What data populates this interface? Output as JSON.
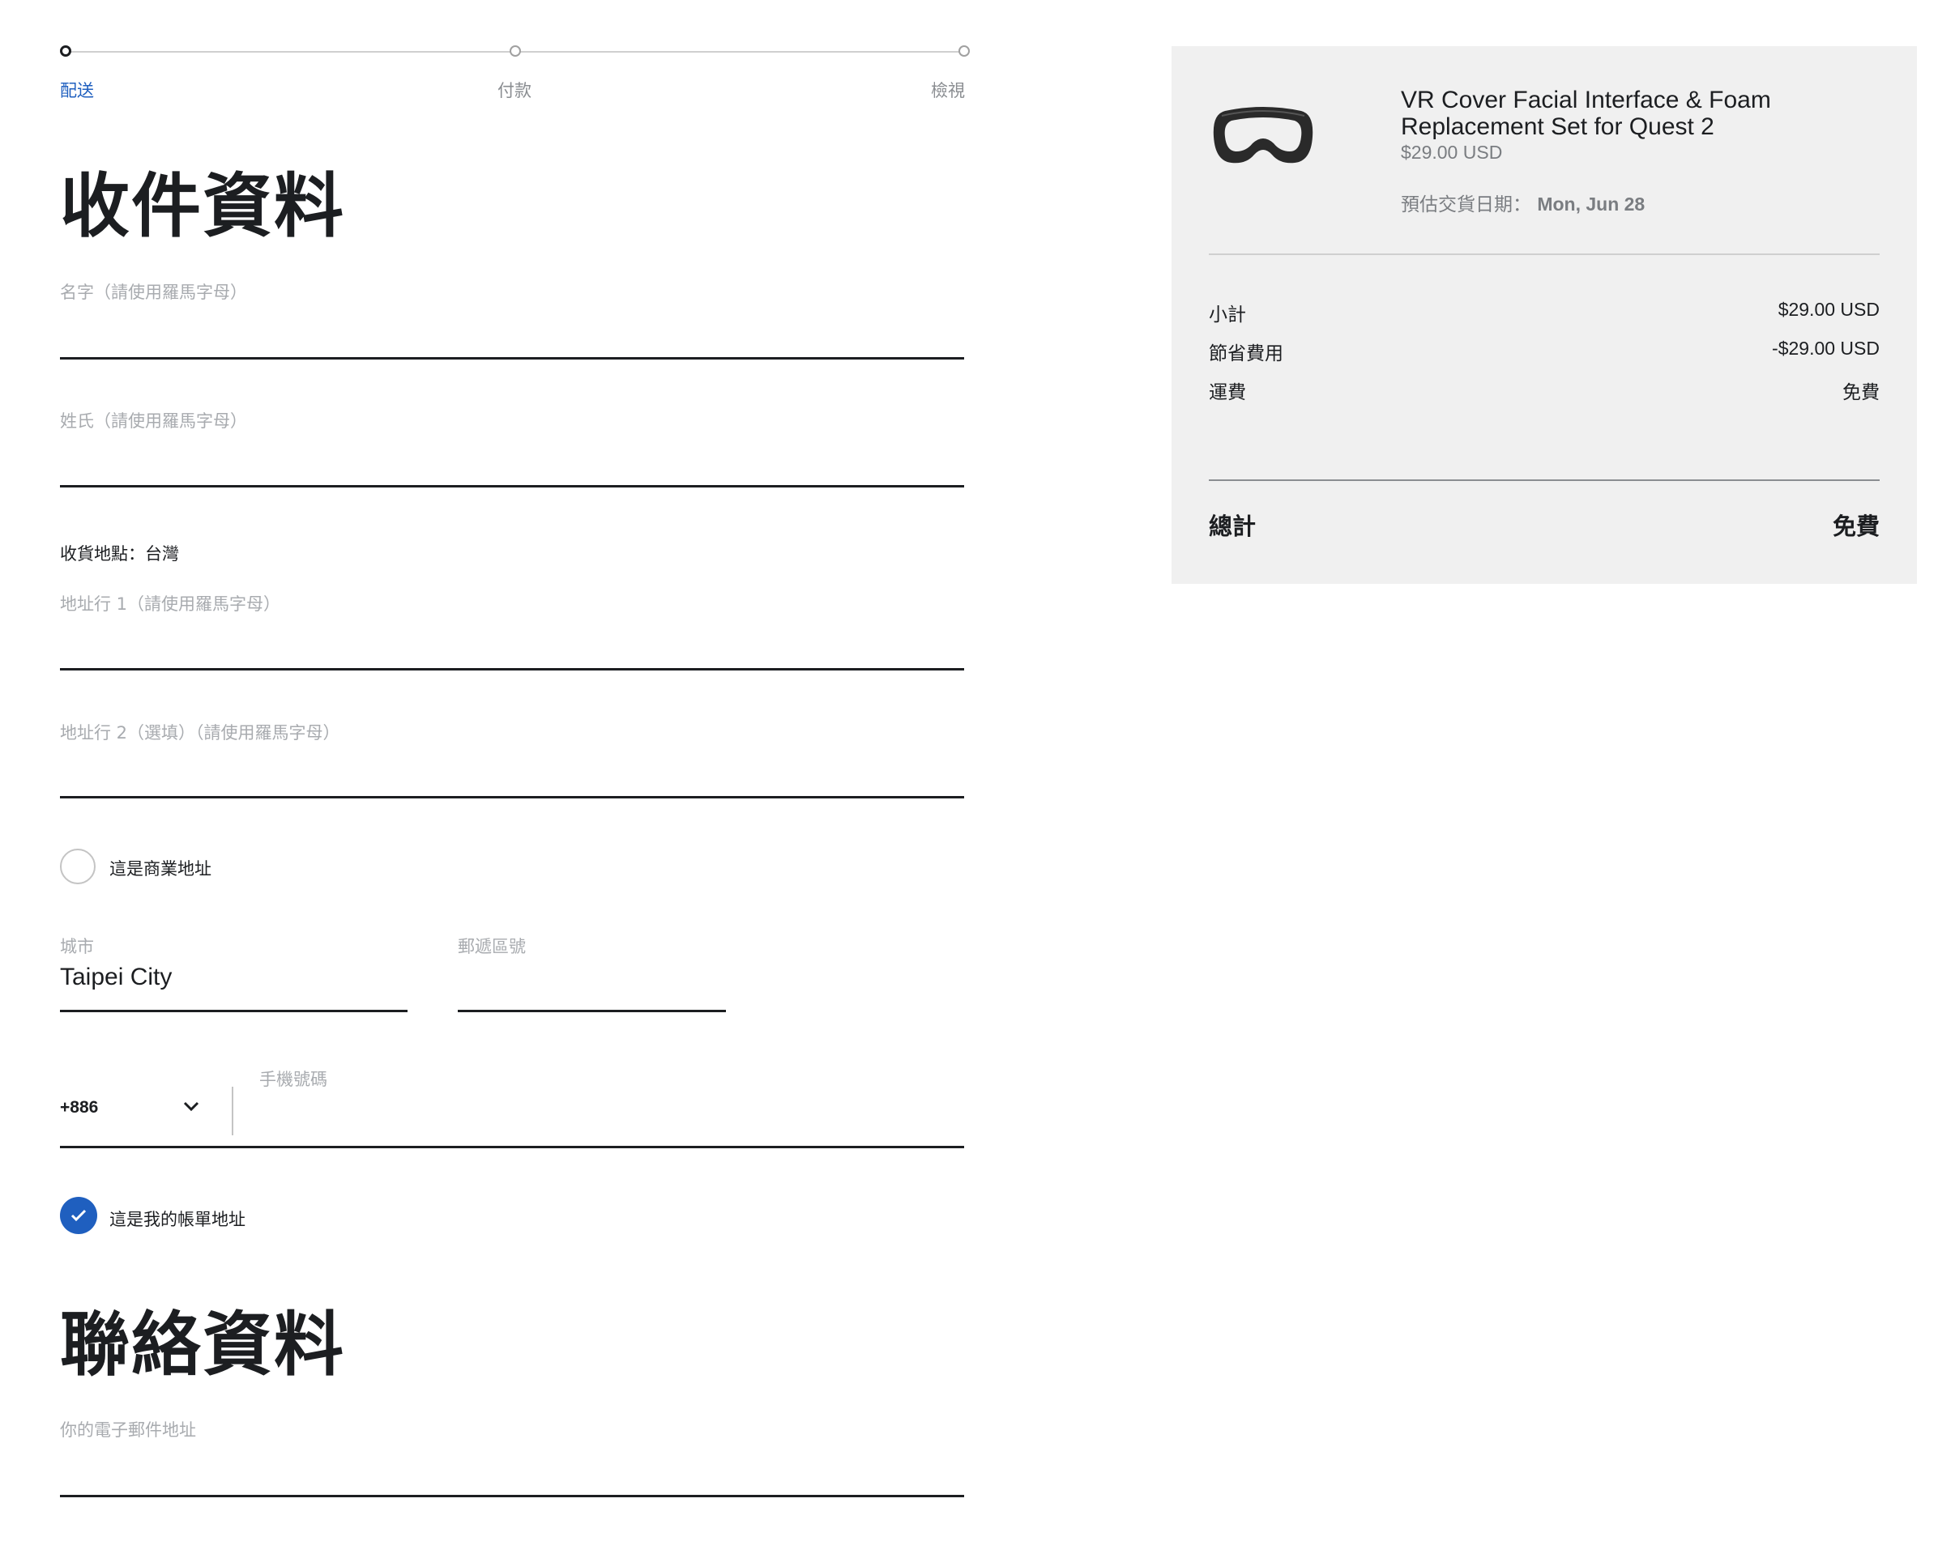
{
  "stepper": {
    "steps": [
      {
        "label": "配送",
        "active": true
      },
      {
        "label": "付款",
        "active": false
      },
      {
        "label": "檢視",
        "active": false
      }
    ],
    "active_color": "#1f5fbf"
  },
  "shipping": {
    "heading": "收件資料",
    "first_name": {
      "label": "名字（請使用羅馬字母）",
      "value": ""
    },
    "last_name": {
      "label": "姓氏（請使用羅馬字母）",
      "value": ""
    },
    "country_prefix": "收貨地點：",
    "country": "台灣",
    "address1": {
      "label": "地址行 1（請使用羅馬字母）",
      "value": ""
    },
    "address2": {
      "label": "地址行 2（選填）（請使用羅馬字母）",
      "value": ""
    },
    "business_checkbox": {
      "label": "這是商業地址",
      "checked": false
    },
    "city": {
      "label": "城市",
      "value": "Taipei City"
    },
    "postal": {
      "label": "郵遞區號",
      "value": ""
    },
    "phone": {
      "country_code": "+886",
      "label": "手機號碼",
      "value": ""
    },
    "billing_checkbox": {
      "label": "這是我的帳單地址",
      "checked": true
    }
  },
  "contact": {
    "heading": "聯絡資料",
    "email": {
      "label": "你的電子郵件地址",
      "value": ""
    }
  },
  "summary": {
    "product": {
      "name_line1": "VR Cover Facial Interface & Foam",
      "name_line2": "Replacement Set for Quest 2",
      "price": "$29.00 USD",
      "delivery_label": "預估交貨日期：",
      "delivery_date": "Mon, Jun 28",
      "image_icon": "vr-facial-interface-icon"
    },
    "rows": [
      {
        "label": "小計",
        "value": "$29.00 USD"
      },
      {
        "label": "節省費用",
        "value": "-$29.00 USD"
      },
      {
        "label": "運費",
        "value": "免費"
      }
    ],
    "total_label": "總計",
    "total_value": "免費"
  }
}
